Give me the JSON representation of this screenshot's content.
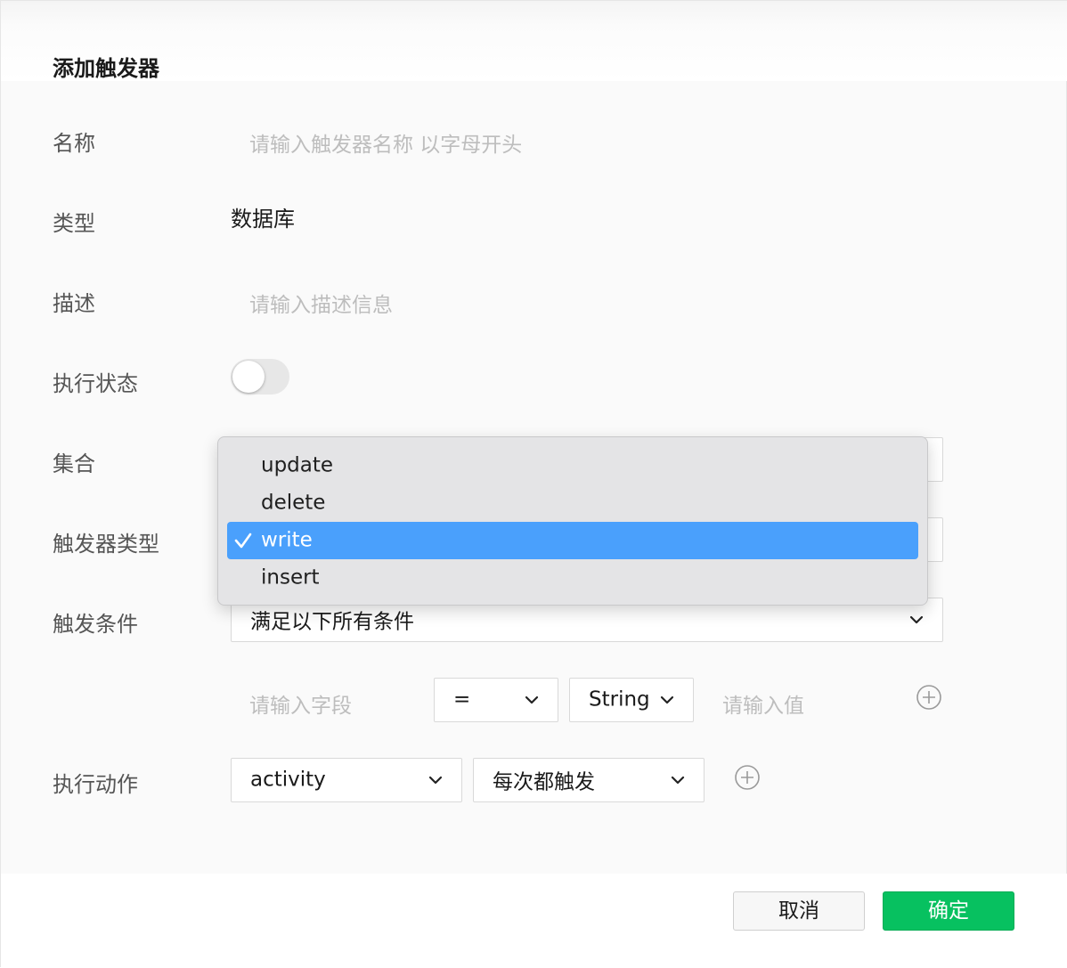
{
  "dialog": {
    "title": "添加触发器"
  },
  "form": {
    "name": {
      "label": "名称",
      "placeholder": "请输入触发器名称 以字母开头"
    },
    "type": {
      "label": "类型",
      "value": "数据库"
    },
    "description": {
      "label": "描述",
      "placeholder": "请输入描述信息"
    },
    "status": {
      "label": "执行状态",
      "enabled": false
    },
    "collection": {
      "label": "集合"
    },
    "trigger_type": {
      "label": "触发器类型"
    },
    "condition": {
      "label": "触发条件",
      "mode_value": "满足以下所有条件",
      "field_placeholder": "请输入字段",
      "operator_value": "=",
      "datatype_value": "String",
      "value_placeholder": "请输入值"
    },
    "action": {
      "label": "执行动作",
      "function_value": "activity",
      "frequency_value": "每次都触发"
    }
  },
  "dropdown": {
    "items": [
      {
        "label": "update",
        "selected": false
      },
      {
        "label": "delete",
        "selected": false
      },
      {
        "label": "write",
        "selected": true
      },
      {
        "label": "insert",
        "selected": false
      }
    ]
  },
  "footer": {
    "cancel_label": "取消",
    "ok_label": "确定"
  },
  "colors": {
    "primary_green": "#07c160",
    "menu_highlight": "#4aa0fc"
  }
}
